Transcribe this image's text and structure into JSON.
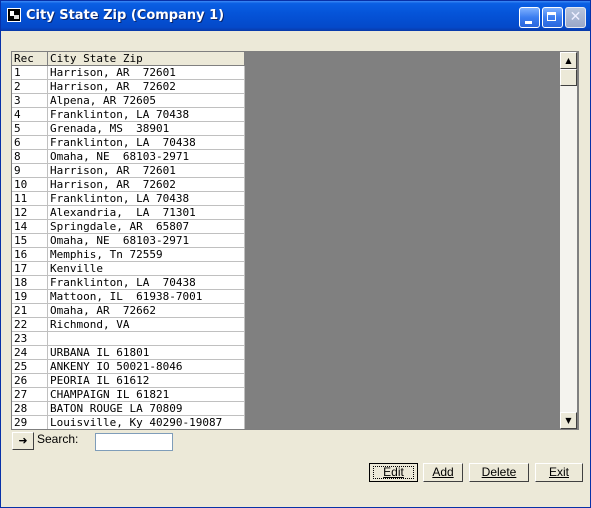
{
  "window": {
    "title": "City State Zip (Company 1)"
  },
  "table": {
    "columns": [
      "Rec",
      "City State Zip"
    ],
    "rows": [
      {
        "rec": "1",
        "csz": "Harrison, AR  72601"
      },
      {
        "rec": "2",
        "csz": "Harrison, AR  72602"
      },
      {
        "rec": "3",
        "csz": "Alpena, AR 72605"
      },
      {
        "rec": "4",
        "csz": "Franklinton, LA 70438"
      },
      {
        "rec": "5",
        "csz": "Grenada, MS  38901"
      },
      {
        "rec": "6",
        "csz": "Franklinton, LA  70438"
      },
      {
        "rec": "8",
        "csz": "Omaha, NE  68103-2971"
      },
      {
        "rec": "9",
        "csz": "Harrison, AR  72601"
      },
      {
        "rec": "10",
        "csz": "Harrison, AR  72602"
      },
      {
        "rec": "11",
        "csz": "Franklinton, LA 70438"
      },
      {
        "rec": "12",
        "csz": "Alexandria,  LA  71301"
      },
      {
        "rec": "14",
        "csz": "Springdale, AR  65807"
      },
      {
        "rec": "15",
        "csz": "Omaha, NE  68103-2971"
      },
      {
        "rec": "16",
        "csz": "Memphis, Tn 72559"
      },
      {
        "rec": "17",
        "csz": "Kenville"
      },
      {
        "rec": "18",
        "csz": "Franklinton, LA  70438"
      },
      {
        "rec": "19",
        "csz": "Mattoon, IL  61938-7001"
      },
      {
        "rec": "21",
        "csz": "Omaha, AR  72662"
      },
      {
        "rec": "22",
        "csz": "Richmond, VA"
      },
      {
        "rec": "23",
        "csz": ""
      },
      {
        "rec": "24",
        "csz": "URBANA IL 61801"
      },
      {
        "rec": "25",
        "csz": "ANKENY IO 50021-8046"
      },
      {
        "rec": "26",
        "csz": "PEORIA IL 61612"
      },
      {
        "rec": "27",
        "csz": "CHAMPAIGN IL 61821"
      },
      {
        "rec": "28",
        "csz": "BATON ROUGE LA 70809"
      },
      {
        "rec": "29",
        "csz": "Louisville, Ky 40290-19087"
      }
    ]
  },
  "search": {
    "label": "Search:",
    "value": ""
  },
  "buttons": {
    "edit": "Edit",
    "add": "Add",
    "delete": "Delete",
    "exit": "Exit"
  },
  "icons": {
    "app": "app-icon",
    "nav": "nav-arrow-icon",
    "scroll_up": "scroll-up-icon",
    "scroll_down": "scroll-down-icon"
  }
}
